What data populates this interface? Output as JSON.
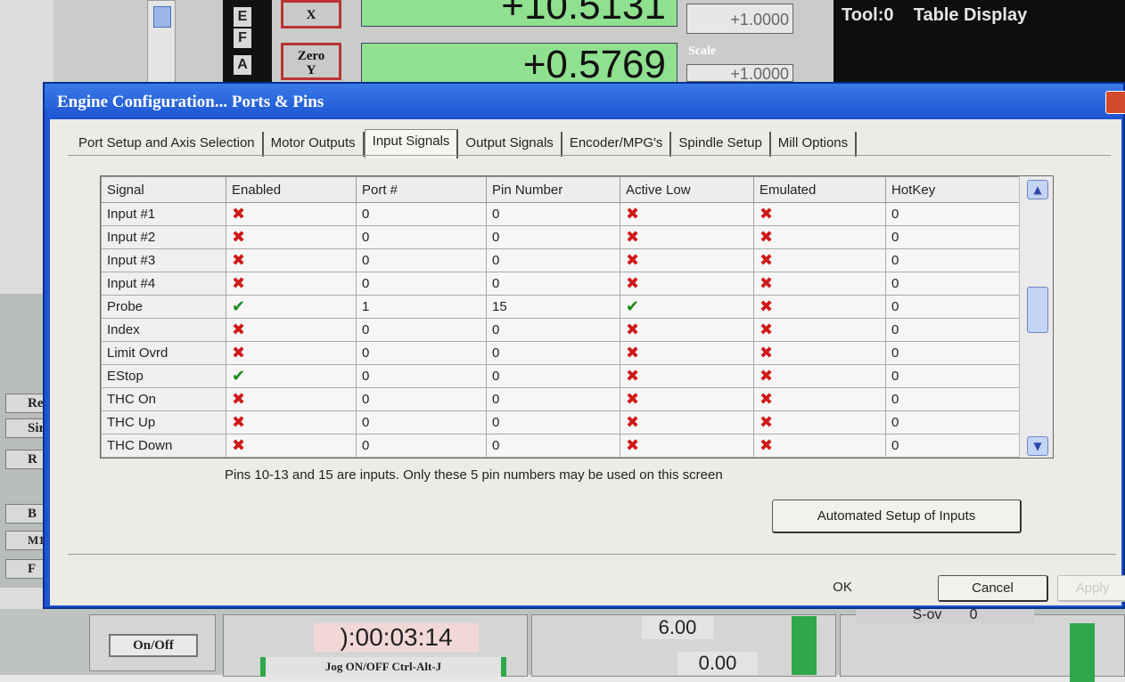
{
  "background": {
    "axis_letters": [
      "E",
      "F",
      "A"
    ],
    "axis_x_label": "X",
    "zero_label": "Zero",
    "zero_axis": "Y",
    "dro_values": [
      "+10.5131",
      "+0.5769"
    ],
    "scale_values": [
      "+1.0000",
      "+1.0000"
    ],
    "scale_label": "Scale",
    "tool_label": "Tool:0",
    "table_display_label": "Table Display",
    "side_buttons": [
      "Re",
      "Sir",
      "R",
      "B",
      "M1",
      "F"
    ],
    "on_off_label": "On/Off",
    "timer": "):00:03:14",
    "jog_label": "Jog ON/OFF Ctrl-Alt-J",
    "value_a": "6.00",
    "value_b": "0.00",
    "sov_label": "S-ov",
    "sov_value": "0"
  },
  "dialog": {
    "title": "Engine Configuration... Ports & Pins",
    "tabs": [
      {
        "label": "Port Setup and Axis Selection",
        "active": false
      },
      {
        "label": "Motor Outputs",
        "active": false
      },
      {
        "label": "Input Signals",
        "active": true
      },
      {
        "label": "Output Signals",
        "active": false
      },
      {
        "label": "Encoder/MPG's",
        "active": false
      },
      {
        "label": "Spindle Setup",
        "active": false
      },
      {
        "label": "Mill Options",
        "active": false
      }
    ],
    "table": {
      "columns": [
        "Signal",
        "Enabled",
        "Port #",
        "Pin Number",
        "Active Low",
        "Emulated",
        "HotKey"
      ],
      "rows": [
        {
          "signal": "Input #1",
          "enabled": false,
          "port": "0",
          "pin": "0",
          "active_low": false,
          "emulated": false,
          "hotkey": "0"
        },
        {
          "signal": "Input #2",
          "enabled": false,
          "port": "0",
          "pin": "0",
          "active_low": false,
          "emulated": false,
          "hotkey": "0"
        },
        {
          "signal": "Input #3",
          "enabled": false,
          "port": "0",
          "pin": "0",
          "active_low": false,
          "emulated": false,
          "hotkey": "0"
        },
        {
          "signal": "Input #4",
          "enabled": false,
          "port": "0",
          "pin": "0",
          "active_low": false,
          "emulated": false,
          "hotkey": "0"
        },
        {
          "signal": "Probe",
          "enabled": true,
          "port": "1",
          "pin": "15",
          "active_low": true,
          "emulated": false,
          "hotkey": "0"
        },
        {
          "signal": "Index",
          "enabled": false,
          "port": "0",
          "pin": "0",
          "active_low": false,
          "emulated": false,
          "hotkey": "0"
        },
        {
          "signal": "Limit Ovrd",
          "enabled": false,
          "port": "0",
          "pin": "0",
          "active_low": false,
          "emulated": false,
          "hotkey": "0"
        },
        {
          "signal": "EStop",
          "enabled": true,
          "port": "0",
          "pin": "0",
          "active_low": false,
          "emulated": false,
          "hotkey": "0"
        },
        {
          "signal": "THC On",
          "enabled": false,
          "port": "0",
          "pin": "0",
          "active_low": false,
          "emulated": false,
          "hotkey": "0"
        },
        {
          "signal": "THC Up",
          "enabled": false,
          "port": "0",
          "pin": "0",
          "active_low": false,
          "emulated": false,
          "hotkey": "0"
        },
        {
          "signal": "THC Down",
          "enabled": false,
          "port": "0",
          "pin": "0",
          "active_low": false,
          "emulated": false,
          "hotkey": "0"
        }
      ]
    },
    "hint": "Pins 10-13 and 15 are inputs. Only these 5 pin numbers may be used on this screen",
    "automated_setup_label": "Automated Setup of Inputs",
    "ok_label": "OK",
    "cancel_label": "Cancel",
    "apply_label": "Apply"
  },
  "icons": {
    "enabled_true": "green-check-icon",
    "enabled_false": "red-x-icon"
  },
  "colors": {
    "title_bar": "#1c54d2",
    "dro_green": "#8fe08f",
    "check_green": "#1a8a1a",
    "x_red": "#d01818"
  }
}
